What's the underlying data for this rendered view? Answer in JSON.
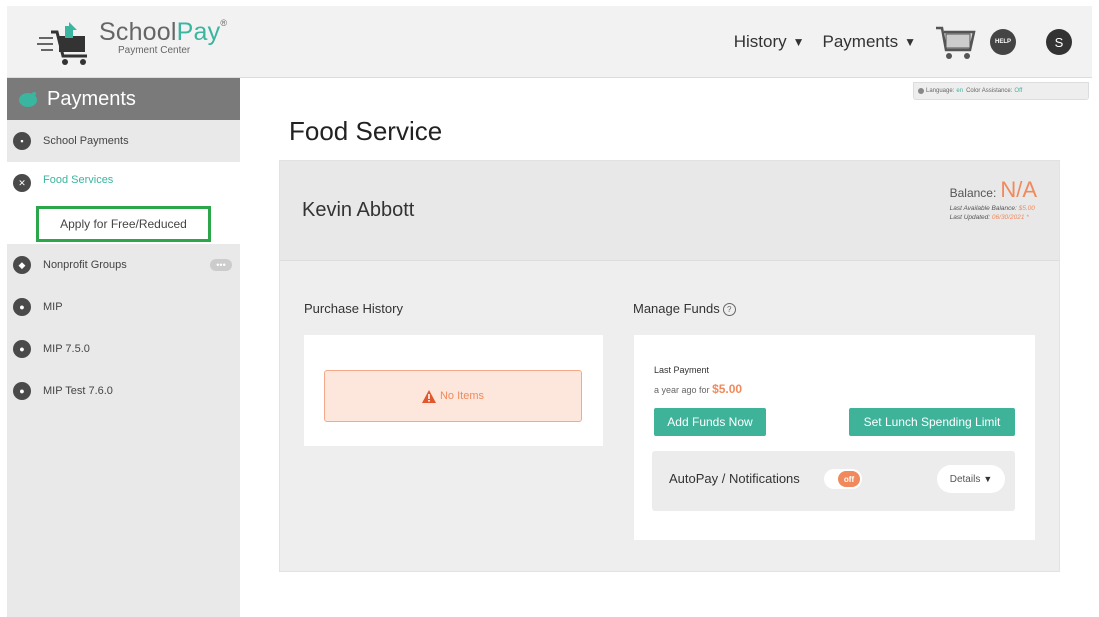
{
  "header": {
    "logo_name_main": "School",
    "logo_name_accent": "Pay",
    "logo_reg": "®",
    "logo_sub": "Payment Center",
    "nav": [
      {
        "label": "History"
      },
      {
        "label": "Payments"
      }
    ],
    "help_label": "HELP",
    "user_initial": "S"
  },
  "lang_bar": {
    "language_label": "Language",
    "language_value": "en",
    "color_label": "Color Assistance",
    "color_value": "Off"
  },
  "sidebar": {
    "header": "Payments",
    "items": [
      {
        "label": "School Payments"
      },
      {
        "label": "Food Services"
      },
      {
        "label": "Apply for Free/Reduced"
      },
      {
        "label": "Nonprofit Groups",
        "badge": "•••"
      },
      {
        "label": "MIP"
      },
      {
        "label": "MIP 7.5.0"
      },
      {
        "label": "MIP Test 7.6.0"
      }
    ]
  },
  "main": {
    "title": "Food Service",
    "student_name": "Kevin Abbott",
    "balance_label": "Balance:",
    "balance_value": "N/A",
    "last_balance_label": "Last Available Balance:",
    "last_balance_value": "$5.00",
    "last_updated_label": "Last Updated:",
    "last_updated_value": "06/30/2021 *",
    "purchase_history_label": "Purchase History",
    "no_items": "No Items",
    "manage_funds_label": "Manage Funds",
    "last_payment_label": "Last Payment",
    "last_payment_when": "a year ago for",
    "last_payment_amount": "$5.00",
    "add_funds_label": "Add Funds Now",
    "spending_limit_label": "Set Lunch Spending Limit",
    "autopay_label": "AutoPay / Notifications",
    "autopay_state": "off",
    "details_label": "Details"
  },
  "colors": {
    "accent": "#39b5a0",
    "warning": "#f08a5d",
    "highlight_box": "#2ca64a"
  }
}
